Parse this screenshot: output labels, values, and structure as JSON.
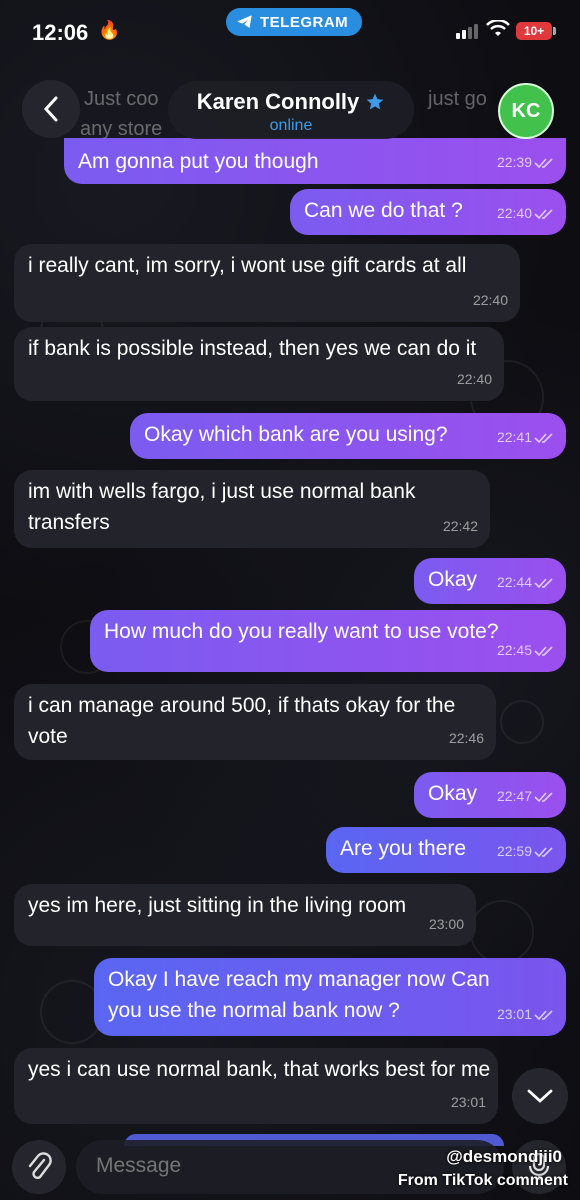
{
  "status_bar": {
    "time": "12:06",
    "app_pill": "TELEGRAM",
    "battery": "10+"
  },
  "header": {
    "contact_name": "Karen Connolly",
    "contact_status": "online",
    "avatar_initials": "KC"
  },
  "ghost_text": {
    "line1": "Just coo",
    "line2": "just go",
    "line3": "any store"
  },
  "messages": [
    {
      "dir": "out",
      "text": "Am gonna put you though",
      "time": "22:39"
    },
    {
      "dir": "out",
      "text": "Can we do that ?",
      "time": "22:40"
    },
    {
      "dir": "in",
      "text": "i really cant, im sorry, i wont use gift cards at all",
      "time": "22:40"
    },
    {
      "dir": "in",
      "text": "if bank is possible instead, then yes we can do it",
      "time": "22:40"
    },
    {
      "dir": "out",
      "text": "Okay which bank are you using?",
      "time": "22:41"
    },
    {
      "dir": "in",
      "text": "im with wells fargo, i just use normal bank transfers",
      "time": "22:42"
    },
    {
      "dir": "out",
      "text": "Okay",
      "time": "22:44"
    },
    {
      "dir": "out",
      "text": "How much do you really want to use vote?",
      "time": "22:45"
    },
    {
      "dir": "in",
      "text": "i can manage around 500, if thats okay for the vote",
      "time": "22:46"
    },
    {
      "dir": "out",
      "text": "Okay",
      "time": "22:47"
    },
    {
      "dir": "out",
      "text": "Are you there",
      "time": "22:59"
    },
    {
      "dir": "in",
      "text": "yes im here, just sitting in the living room",
      "time": "23:00"
    },
    {
      "dir": "out",
      "text": "Okay I have reach my manager now Can you use the normal bank now ?",
      "time": "23:01"
    },
    {
      "dir": "in",
      "text": "yes i can use normal bank, that works best for me",
      "time": "23:01"
    }
  ],
  "composer": {
    "placeholder": "Message"
  },
  "watermark": {
    "handle": "@desmondjii0",
    "source": "From TikTok comment"
  },
  "colors": {
    "outgoing": "#8a55ef",
    "incoming": "#23232b",
    "online": "#3d9be9",
    "avatar": "#42c14c"
  }
}
